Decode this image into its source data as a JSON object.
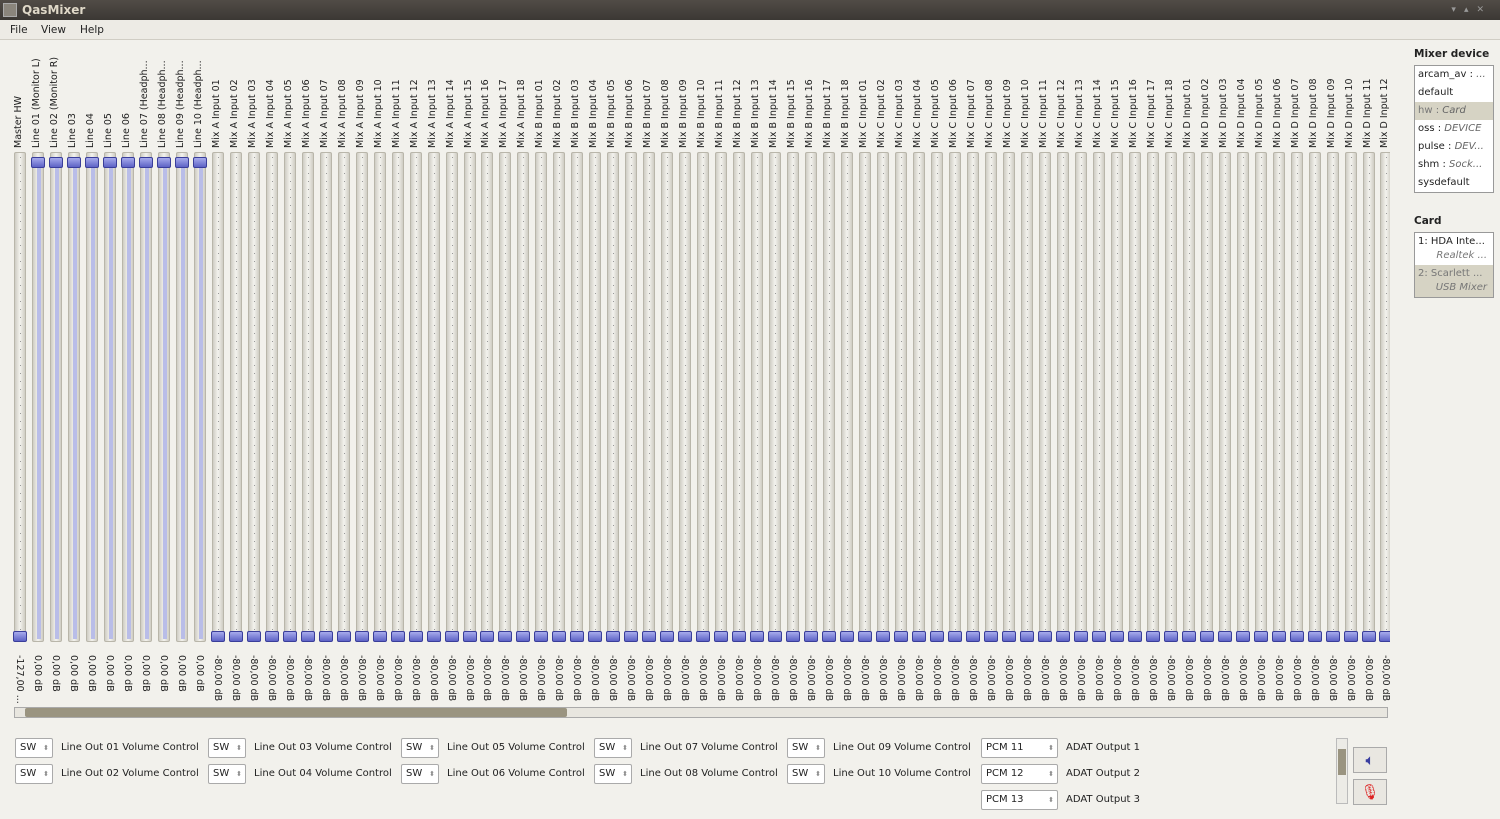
{
  "window": {
    "title": "QasMixer"
  },
  "menu": [
    "File",
    "View",
    "Help"
  ],
  "channels": {
    "names": [
      "Master HW",
      "Line 01 (Monitor L)",
      "Line 02 (Monitor R)",
      "Line 03",
      "Line 04",
      "Line 05",
      "Line 06",
      "Line 07 (Headph...",
      "Line 08 (Headph...",
      "Line 09 (Headph...",
      "Line 10 (Headph...",
      "Mix A Input 01",
      "Mix A Input 02",
      "Mix A Input 03",
      "Mix A Input 04",
      "Mix A Input 05",
      "Mix A Input 06",
      "Mix A Input 07",
      "Mix A Input 08",
      "Mix A Input 09",
      "Mix A Input 10",
      "Mix A Input 11",
      "Mix A Input 12",
      "Mix A Input 13",
      "Mix A Input 14",
      "Mix A Input 15",
      "Mix A Input 16",
      "Mix A Input 17",
      "Mix A Input 18",
      "Mix B Input 01",
      "Mix B Input 02",
      "Mix B Input 03",
      "Mix B Input 04",
      "Mix B Input 05",
      "Mix B Input 06",
      "Mix B Input 07",
      "Mix B Input 08",
      "Mix B Input 09",
      "Mix B Input 10",
      "Mix B Input 11",
      "Mix B Input 12",
      "Mix B Input 13",
      "Mix B Input 14",
      "Mix B Input 15",
      "Mix B Input 16",
      "Mix B Input 17",
      "Mix B Input 18",
      "Mix C Input 01",
      "Mix C Input 02",
      "Mix C Input 03",
      "Mix C Input 04",
      "Mix C Input 05",
      "Mix C Input 06",
      "Mix C Input 07",
      "Mix C Input 08",
      "Mix C Input 09",
      "Mix C Input 10",
      "Mix C Input 11",
      "Mix C Input 12",
      "Mix C Input 13",
      "Mix C Input 14",
      "Mix C Input 15",
      "Mix C Input 16",
      "Mix C Input 17",
      "Mix C Input 18",
      "Mix D Input 01",
      "Mix D Input 02",
      "Mix D Input 03",
      "Mix D Input 04",
      "Mix D Input 05",
      "Mix D Input 06",
      "Mix D Input 07",
      "Mix D Input 08",
      "Mix D Input 09",
      "Mix D Input 10",
      "Mix D Input 11",
      "Mix D Input 12"
    ],
    "master_value": "-127,00 ...",
    "master_level": 0,
    "line_value": "0,00 dB",
    "line_level": 1,
    "mix_value": "-80,00 dB",
    "mix_level": 0
  },
  "mixer_device": {
    "title": "Mixer device",
    "items": [
      {
        "name": "arcam_av",
        "desc": "..."
      },
      {
        "name": "default",
        "desc": ""
      },
      {
        "name": "hw",
        "desc": "Card",
        "selected": true
      },
      {
        "name": "oss",
        "desc": "DEVICE"
      },
      {
        "name": "pulse",
        "desc": "DEV..."
      },
      {
        "name": "shm",
        "desc": "Sock..."
      },
      {
        "name": "sysdefault",
        "desc": ""
      }
    ]
  },
  "card": {
    "title": "Card",
    "items": [
      {
        "name": "1: HDA Inte...",
        "sub": "Realtek ..."
      },
      {
        "name": "2: Scarlett ...",
        "sub": "USB Mixer",
        "selected": true
      }
    ]
  },
  "controls": [
    {
      "sel": "SW",
      "label": "Line Out 01 Volume Control"
    },
    {
      "sel": "SW",
      "label": "Line Out 02 Volume Control"
    },
    {
      "sel": "SW",
      "label": "Line Out 03 Volume Control"
    },
    {
      "sel": "SW",
      "label": "Line Out 04 Volume Control"
    },
    {
      "sel": "SW",
      "label": "Line Out 05 Volume Control"
    },
    {
      "sel": "SW",
      "label": "Line Out 06 Volume Control"
    },
    {
      "sel": "SW",
      "label": "Line Out 07 Volume Control"
    },
    {
      "sel": "SW",
      "label": "Line Out 08 Volume Control"
    },
    {
      "sel": "SW",
      "label": "Line Out 09 Volume Control"
    },
    {
      "sel": "SW",
      "label": "Line Out 10 Volume Control"
    }
  ],
  "adat": [
    {
      "sel": "PCM 11",
      "label": "ADAT Output 1"
    },
    {
      "sel": "PCM 12",
      "label": "ADAT Output 2"
    },
    {
      "sel": "PCM 13",
      "label": "ADAT Output 3"
    }
  ],
  "icons": {
    "playback": "speaker-icon",
    "capture": "microphone-icon"
  }
}
